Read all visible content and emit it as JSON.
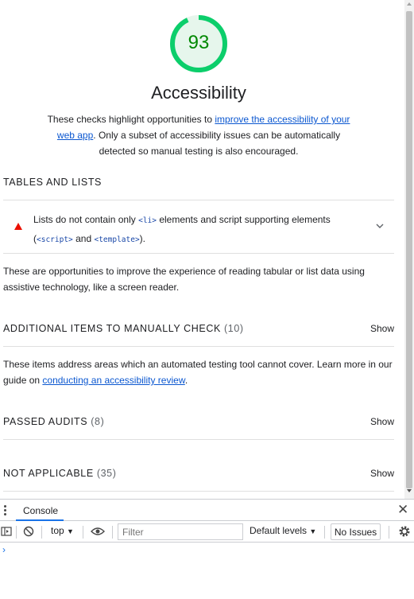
{
  "gauge": {
    "score": "93",
    "score_fraction": 0.93,
    "color": "#0cce6b",
    "text_color": "#008800"
  },
  "category": {
    "title": "Accessibility",
    "description_prefix": "These checks highlight opportunities to ",
    "description_link": "improve the accessibility of your web app",
    "description_suffix": ". Only a subset of accessibility issues can be automatically detected so manual testing is also encouraged."
  },
  "tables_and_lists": {
    "header": "TABLES AND LISTS",
    "audit": {
      "title_1": "Lists do not contain only ",
      "code_li": "<li>",
      "title_2": " elements and script supporting elements (",
      "code_script": "<script>",
      "title_3": " and ",
      "code_template": "<template>",
      "title_4": ").",
      "status_icon": "fail-triangle-icon",
      "status_color": "#eb0f00"
    },
    "description": "These are opportunities to improve the experience of reading tabular or list data using assistive technology, like a screen reader."
  },
  "manual": {
    "header": "ADDITIONAL ITEMS TO MANUALLY CHECK",
    "count": "(10)",
    "show": "Show",
    "description_prefix": "These items address areas which an automated testing tool cannot cover. Learn more in our guide on ",
    "description_link": "conducting an accessibility review",
    "description_suffix": "."
  },
  "passed": {
    "header": "PASSED AUDITS",
    "count": "(8)",
    "show": "Show"
  },
  "not_applicable": {
    "header": "NOT APPLICABLE",
    "count": "(35)",
    "show": "Show"
  },
  "devtools": {
    "tab": "Console",
    "context": "top",
    "filter_placeholder": "Filter",
    "levels": "Default levels",
    "issues": "No Issues",
    "prompt": "›",
    "accent": "#1a73e8"
  }
}
